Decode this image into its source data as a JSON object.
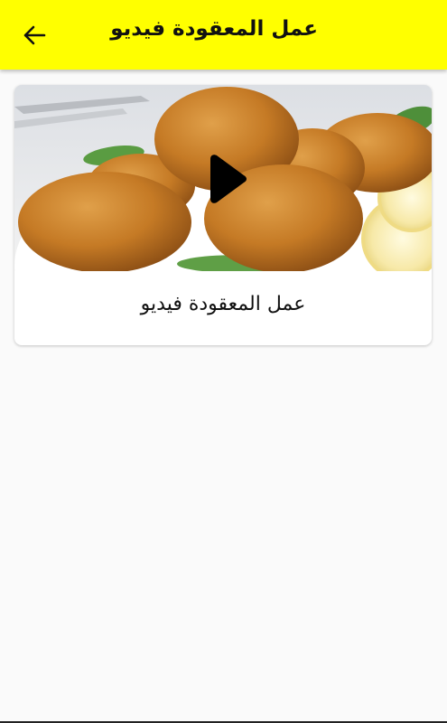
{
  "app_bar": {
    "title": "عمل المعقودة فيديو",
    "back_icon": "arrow-left-icon",
    "background_color": "#ffff00"
  },
  "video_card": {
    "title": "عمل المعقودة فيديو",
    "thumbnail": "fried-makouda-balls-with-lemon",
    "play_icon": "play-icon"
  }
}
